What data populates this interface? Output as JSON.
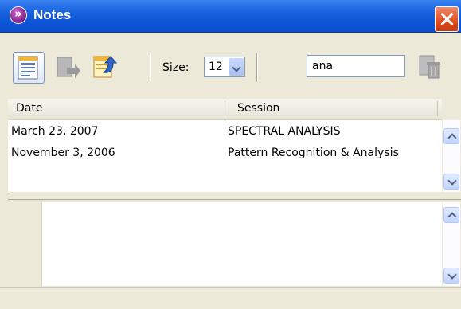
{
  "window": {
    "title": "Notes"
  },
  "toolbar": {
    "size_label": "Size:",
    "size_value": "12",
    "search_value": "ana"
  },
  "table": {
    "columns": [
      "Date",
      "Session"
    ],
    "rows": [
      {
        "date": "March 23, 2007",
        "session": "SPECTRAL ANALYSIS"
      },
      {
        "date": "November 3, 2006",
        "session": "Pattern Recognition & Analysis"
      }
    ]
  },
  "colors": {
    "titlebar": "#0c55d6",
    "close_button": "#e04d1c",
    "window_bg": "#ece9d8"
  },
  "icons": [
    "notes-list-icon",
    "export-icon",
    "import-icon",
    "delete-icon",
    "chevron-down-icon",
    "scroll-up-icon",
    "scroll-down-icon"
  ]
}
